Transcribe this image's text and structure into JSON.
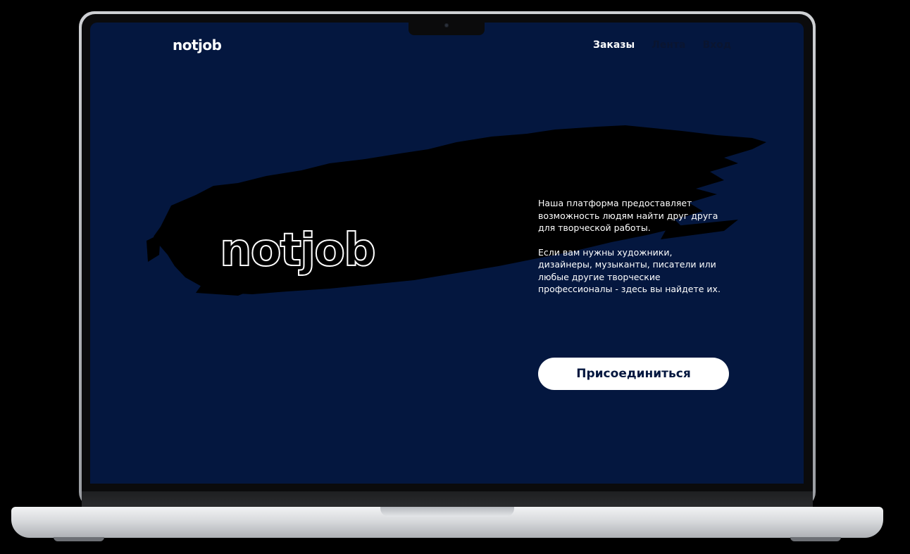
{
  "header": {
    "logo": "notjob",
    "nav": [
      {
        "label": "Заказы",
        "active": true
      },
      {
        "label": "Лента",
        "active": false
      },
      {
        "label": "Вход",
        "active": false
      }
    ]
  },
  "hero": {
    "title": "notjob",
    "description_1": "Наша платформа предоставляет возможность людям найти друг друга для творческой работы.",
    "description_2": "Если вам нужны художники, дизайнеры, музыканты, писатели или любые другие творческие профессионалы - здесь вы найдете их.",
    "cta_label": "Присоединиться"
  },
  "colors": {
    "background": "#04173f",
    "brush": "#000000",
    "button_bg": "#ffffff",
    "button_text": "#04173f"
  }
}
